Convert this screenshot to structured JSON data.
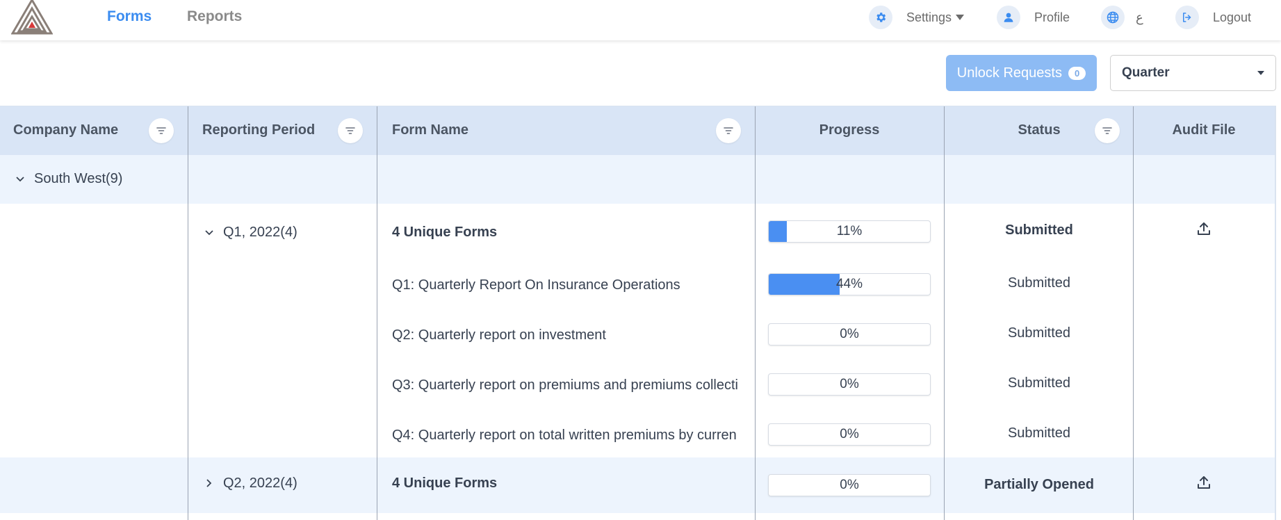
{
  "nav": {
    "links": [
      {
        "label": "Forms",
        "active": true
      },
      {
        "label": "Reports",
        "active": false
      }
    ],
    "settings_label": "Settings",
    "profile_label": "Profile",
    "language_label": "ع",
    "logout_label": "Logout"
  },
  "toolbar": {
    "unlock_label": "Unlock Requests",
    "unlock_count": "0",
    "period_value": "Quarter"
  },
  "table": {
    "columns": [
      "Company Name",
      "Reporting Period",
      "Form Name",
      "Progress",
      "Status",
      "Audit File"
    ],
    "group": {
      "company": "South West(9)"
    },
    "periods": [
      {
        "label": "Q1, 2022(4)",
        "summary": {
          "form": "4 Unique Forms",
          "progress_pct": 11,
          "progress_label": "11%",
          "status": "Submitted"
        },
        "forms": [
          {
            "name": "Q1: Quarterly Report On Insurance Operations",
            "progress_pct": 44,
            "progress_label": "44%",
            "status": "Submitted"
          },
          {
            "name": "Q2: Quarterly report on investment",
            "progress_pct": 0,
            "progress_label": "0%",
            "status": "Submitted"
          },
          {
            "name": "Q3: Quarterly report on premiums and premiums collecti",
            "progress_pct": 0,
            "progress_label": "0%",
            "status": "Submitted"
          },
          {
            "name": "Q4: Quarterly report on total written premiums by curren",
            "progress_pct": 0,
            "progress_label": "0%",
            "status": "Submitted"
          }
        ]
      },
      {
        "label": "Q2, 2022(4)",
        "summary": {
          "form": "4 Unique Forms",
          "progress_pct": 0,
          "progress_label": "0%",
          "status": "Partially Opened"
        }
      }
    ]
  },
  "colors": {
    "accent": "#3b8cf0",
    "progress_fill": "#4a8ff2",
    "header_bg": "#d9e5f6",
    "group_bg": "#edf4fd",
    "unlock_bg": "#8dbbf4"
  },
  "icons": {
    "logo": "triangle-logo",
    "settings": "gear-icon",
    "profile": "user-icon",
    "language": "globe-icon",
    "logout": "logout-icon",
    "filter": "filter-icon",
    "expand": "chevron-down-icon",
    "collapse": "chevron-right-icon",
    "upload": "upload-icon"
  }
}
